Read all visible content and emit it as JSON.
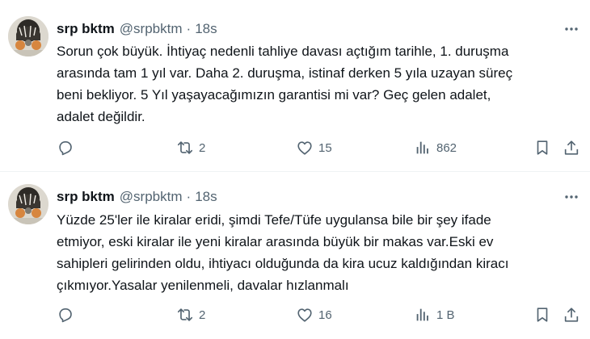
{
  "tweets": [
    {
      "author_name": "srp bktm",
      "handle": "@srpbktm",
      "separator": "·",
      "time": "18s",
      "text_lines": [
        "Sorun çok büyük. İhtiyaç nedenli tahliye davası açtığım tarihle, 1. duruşma",
        "arasında tam 1 yıl var. Daha 2. duruşma, istinaf derken 5 yıla uzayan süreç",
        "beni bekliyor. 5 Yıl yaşayacağımızın garantisi mi var? Geç gelen adalet,",
        "adalet değildir."
      ],
      "retweets": "2",
      "likes": "15",
      "views": "862"
    },
    {
      "author_name": "srp bktm",
      "handle": "@srpbktm",
      "separator": "·",
      "time": "18s",
      "text_lines": [
        "Yüzde 25'ler ile kiralar eridi, şimdi  Tefe/Tüfe uygulansa bile bir şey ifade",
        "etmiyor, eski kiralar ile yeni kiralar arasında büyük bir makas var.Eski ev",
        "sahipleri gelirinden oldu, ihtiyacı olduğunda da kira ucuz kaldığından kiracı",
        "çıkmıyor.Yasalar yenilenmeli, davalar hızlanmalı"
      ],
      "retweets": "2",
      "likes": "16",
      "views": "1 B"
    }
  ],
  "colors": {
    "text_primary": "#0f1419",
    "text_secondary": "#536471",
    "divider": "#eff3f4"
  },
  "icons": {
    "more": "ellipsis-icon",
    "reply": "reply-icon",
    "retweet": "retweet-icon",
    "like": "heart-icon",
    "views": "views-icon",
    "bookmark": "bookmark-icon",
    "share": "share-icon"
  }
}
